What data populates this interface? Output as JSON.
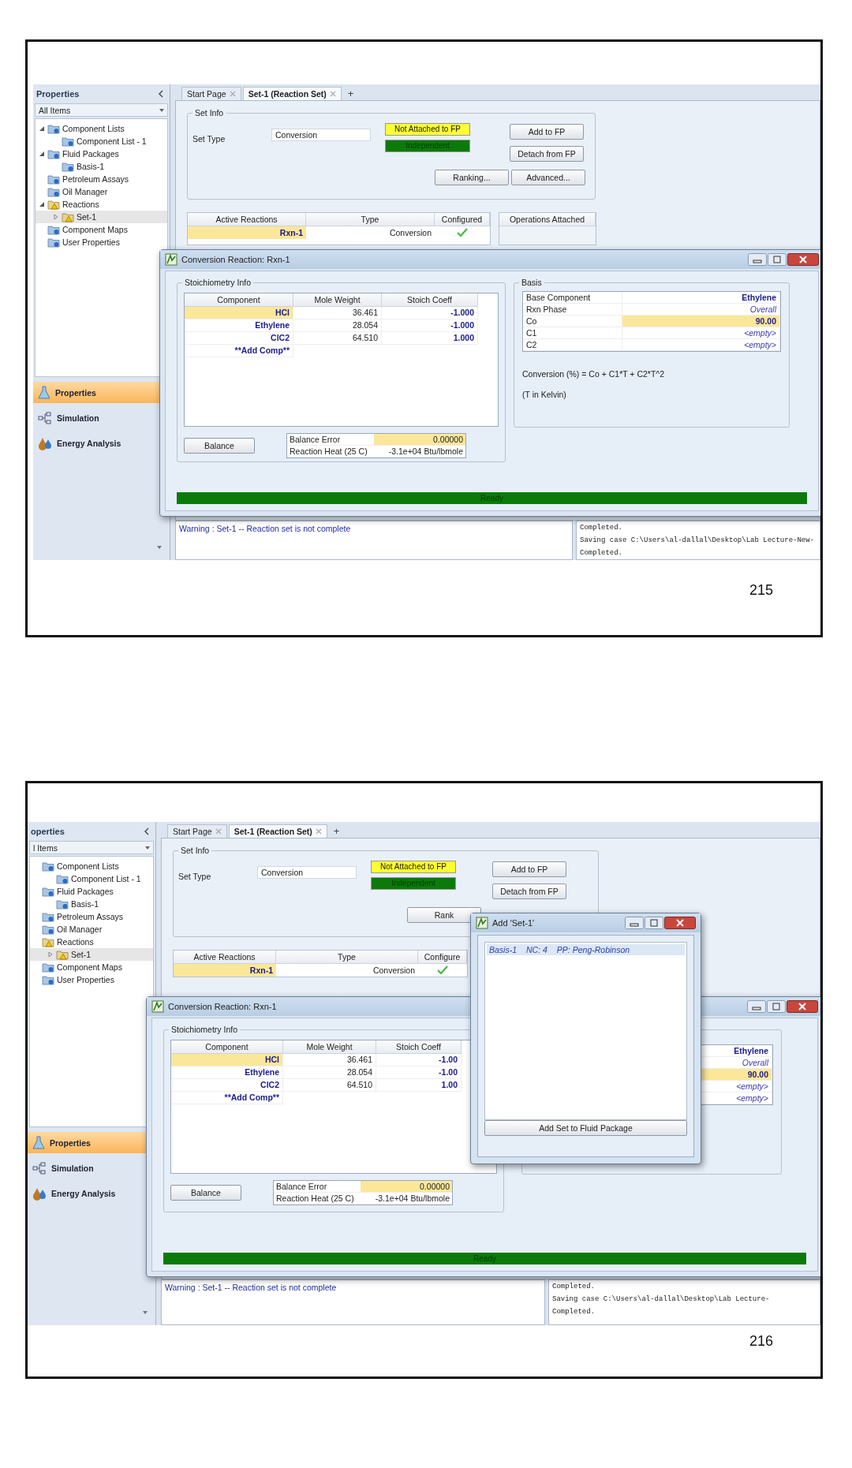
{
  "slides": [
    {
      "page_number": "215",
      "screen": {
        "sidebar": {
          "title": "Properties",
          "filter": "All Items",
          "tree": [
            {
              "label": "Component Lists",
              "kind": "folder",
              "expanded": true,
              "selected": false,
              "children": [
                {
                  "label": "Component List - 1",
                  "kind": "folder",
                  "selected": false
                }
              ]
            },
            {
              "label": "Fluid Packages",
              "kind": "folder",
              "expanded": true,
              "selected": false,
              "children": [
                {
                  "label": "Basis-1",
                  "kind": "folder",
                  "selected": false
                }
              ]
            },
            {
              "label": "Petroleum Assays",
              "kind": "folder",
              "selected": false
            },
            {
              "label": "Oil Manager",
              "kind": "folder",
              "selected": false
            },
            {
              "label": "Reactions",
              "kind": "warning",
              "expanded": true,
              "selected": false,
              "children": [
                {
                  "label": "Set-1",
                  "kind": "warning",
                  "expanded": false,
                  "selected": true
                }
              ]
            },
            {
              "label": "Component Maps",
              "kind": "folder",
              "selected": false
            },
            {
              "label": "User Properties",
              "kind": "folder",
              "selected": false
            }
          ],
          "nav": [
            {
              "label": "Properties",
              "selected": true
            },
            {
              "label": "Simulation",
              "selected": false
            },
            {
              "label": "Energy Analysis",
              "selected": false
            }
          ]
        },
        "tabs": [
          {
            "label": "Start Page",
            "selected": false
          },
          {
            "label": "Set-1 (Reaction Set)",
            "selected": true
          }
        ],
        "new_tab": "+",
        "set_info": {
          "legend": "Set Info",
          "label": "Set Type",
          "value": "Conversion",
          "statuses": [
            {
              "label": "Not Attached to FP",
              "color": "#ffff33"
            },
            {
              "label": "Independent",
              "color": "#0b7a0b"
            }
          ],
          "side_buttons": [
            "Add to FP",
            "Detach from FP"
          ],
          "bottom_buttons": [
            "Ranking...",
            "Advanced..."
          ]
        },
        "reactions_table": {
          "columns": [
            "Active Reactions",
            "Type",
            "Configured"
          ],
          "rows": [
            {
              "name": "Rxn-1",
              "type": "Conversion",
              "configured": true
            }
          ]
        },
        "operations_table": {
          "columns": [
            "Operations Attached"
          ]
        },
        "messages": {
          "warnings": [
            "Warning : Set-1 -- Reaction set is not complete"
          ],
          "log": [
            "Completed.",
            "Saving case C:\\Users\\al-dallal\\Desktop\\Lab Lecture-New-",
            "Completed."
          ]
        },
        "conversion_dialog": {
          "title": "Conversion Reaction: Rxn-1",
          "stoich": {
            "legend": "Stoichiometry Info",
            "columns": [
              "Component",
              "Mole Weight",
              "Stoich Coeff"
            ],
            "rows": [
              {
                "component": "HCl",
                "mole_weight": "36.461",
                "stoich_coeff": "-1.000",
                "selected": true
              },
              {
                "component": "Ethylene",
                "mole_weight": "28.054",
                "stoich_coeff": "-1.000",
                "selected": false
              },
              {
                "component": "ClC2",
                "mole_weight": "64.510",
                "stoich_coeff": "1.000",
                "selected": false
              },
              {
                "component": "**Add Comp**",
                "selected": false
              }
            ]
          },
          "balance_button": "Balance",
          "balance": [
            {
              "label": "Balance Error",
              "value": "0.00000",
              "selected": true
            },
            {
              "label": "Reaction Heat (25 C)",
              "value": "-3.1e+04 Btu/lbmole",
              "selected": false
            }
          ],
          "basis": {
            "legend": "Basis",
            "rows": [
              {
                "label": "Base Component",
                "value": "Ethylene",
                "kind": "bold",
                "selected": false
              },
              {
                "label": "Rxn Phase",
                "value": "Overall",
                "kind": "italic",
                "selected": false
              },
              {
                "label": "Co",
                "value": "90.00",
                "kind": "bold",
                "selected": true
              },
              {
                "label": "C1",
                "value": "<empty>",
                "kind": "italic",
                "selected": false
              },
              {
                "label": "C2",
                "value": "<empty>",
                "kind": "italic",
                "selected": false
              }
            ],
            "formula": "Conversion (%) = Co + C1*T + C2*T^2",
            "note": "(T in Kelvin)"
          },
          "status_bar": "Ready"
        }
      }
    },
    {
      "page_number": "216",
      "screen": {
        "sidebar": {
          "title": "operties",
          "filter": "l Items",
          "tree": [
            {
              "label": "Component Lists",
              "kind": "folder",
              "selected": false,
              "children": [
                {
                  "label": "Component List - 1",
                  "kind": "folder",
                  "selected": false
                }
              ]
            },
            {
              "label": "Fluid Packages",
              "kind": "folder",
              "selected": false,
              "children": [
                {
                  "label": "Basis-1",
                  "kind": "folder",
                  "selected": false
                }
              ]
            },
            {
              "label": "Petroleum Assays",
              "kind": "folder",
              "selected": false
            },
            {
              "label": "Oil Manager",
              "kind": "folder",
              "selected": false
            },
            {
              "label": "Reactions",
              "kind": "warning",
              "selected": false,
              "children": [
                {
                  "label": "Set-1",
                  "kind": "warning",
                  "expanded": false,
                  "selected": true
                }
              ]
            },
            {
              "label": "Component Maps",
              "kind": "folder",
              "selected": false
            },
            {
              "label": "User Properties",
              "kind": "folder",
              "selected": false
            }
          ],
          "nav": [
            {
              "label": "Properties",
              "selected": true
            },
            {
              "label": "Simulation",
              "selected": false
            },
            {
              "label": "Energy Analysis",
              "selected": false
            }
          ]
        },
        "tabs": [
          {
            "label": "Start Page",
            "selected": false
          },
          {
            "label": "Set-1 (Reaction Set)",
            "selected": true
          }
        ],
        "new_tab": "+",
        "set_info": {
          "legend": "Set Info",
          "label": "Set Type",
          "value": "Conversion",
          "statuses": [
            {
              "label": "Not Attached to FP",
              "color": "#ffff33"
            },
            {
              "label": "Independent",
              "color": "#0b7a0b"
            }
          ],
          "side_buttons": [
            "Add to FP",
            "Detach from FP"
          ],
          "bottom_buttons": [
            "Rank"
          ]
        },
        "reactions_table": {
          "columns": [
            "Active Reactions",
            "Type",
            "Configure"
          ],
          "rows": [
            {
              "name": "Rxn-1",
              "type": "Conversion",
              "configured": true
            }
          ]
        },
        "messages": {
          "warnings": [
            "Warning : Set-1 -- Reaction set is not complete"
          ],
          "log": [
            "Completed.",
            "Saving case C:\\Users\\al-dallal\\Desktop\\Lab Lecture-",
            "Completed."
          ]
        },
        "conversion_dialog": {
          "title": "Conversion Reaction: Rxn-1",
          "stoich": {
            "legend": "Stoichiometry Info",
            "columns": [
              "Component",
              "Mole Weight",
              "Stoich Coeff"
            ],
            "rows": [
              {
                "component": "HCl",
                "mole_weight": "36.461",
                "stoich_coeff": "-1.00",
                "selected": true
              },
              {
                "component": "Ethylene",
                "mole_weight": "28.054",
                "stoich_coeff": "-1.00",
                "selected": false
              },
              {
                "component": "ClC2",
                "mole_weight": "64.510",
                "stoich_coeff": "1.00",
                "selected": false
              },
              {
                "component": "**Add Comp**",
                "selected": false
              }
            ]
          },
          "balance_button": "Balance",
          "balance": [
            {
              "label": "Balance Error",
              "value": "0.00000",
              "selected": true
            },
            {
              "label": "Reaction Heat (25 C)",
              "value": "-3.1e+04 Btu/lbmole",
              "selected": false
            }
          ],
          "basis": {
            "rows": [
              {
                "value": "Ethylene",
                "kind": "bold",
                "selected": false
              },
              {
                "value": "Overall",
                "kind": "italic",
                "selected": false
              },
              {
                "value": "90.00",
                "kind": "bold",
                "selected": true
              },
              {
                "value": "<empty>",
                "kind": "italic",
                "selected": false
              },
              {
                "value": "<empty>",
                "kind": "italic",
                "selected": false
              }
            ]
          },
          "status_bar": "Ready"
        },
        "add_dialog": {
          "title": "Add 'Set-1'",
          "items": [
            {
              "name": "Basis-1",
              "nc": "NC: 4",
              "pp": "PP: Peng-Robinson",
              "selected": true
            }
          ],
          "button": "Add Set to Fluid Package"
        }
      }
    }
  ]
}
